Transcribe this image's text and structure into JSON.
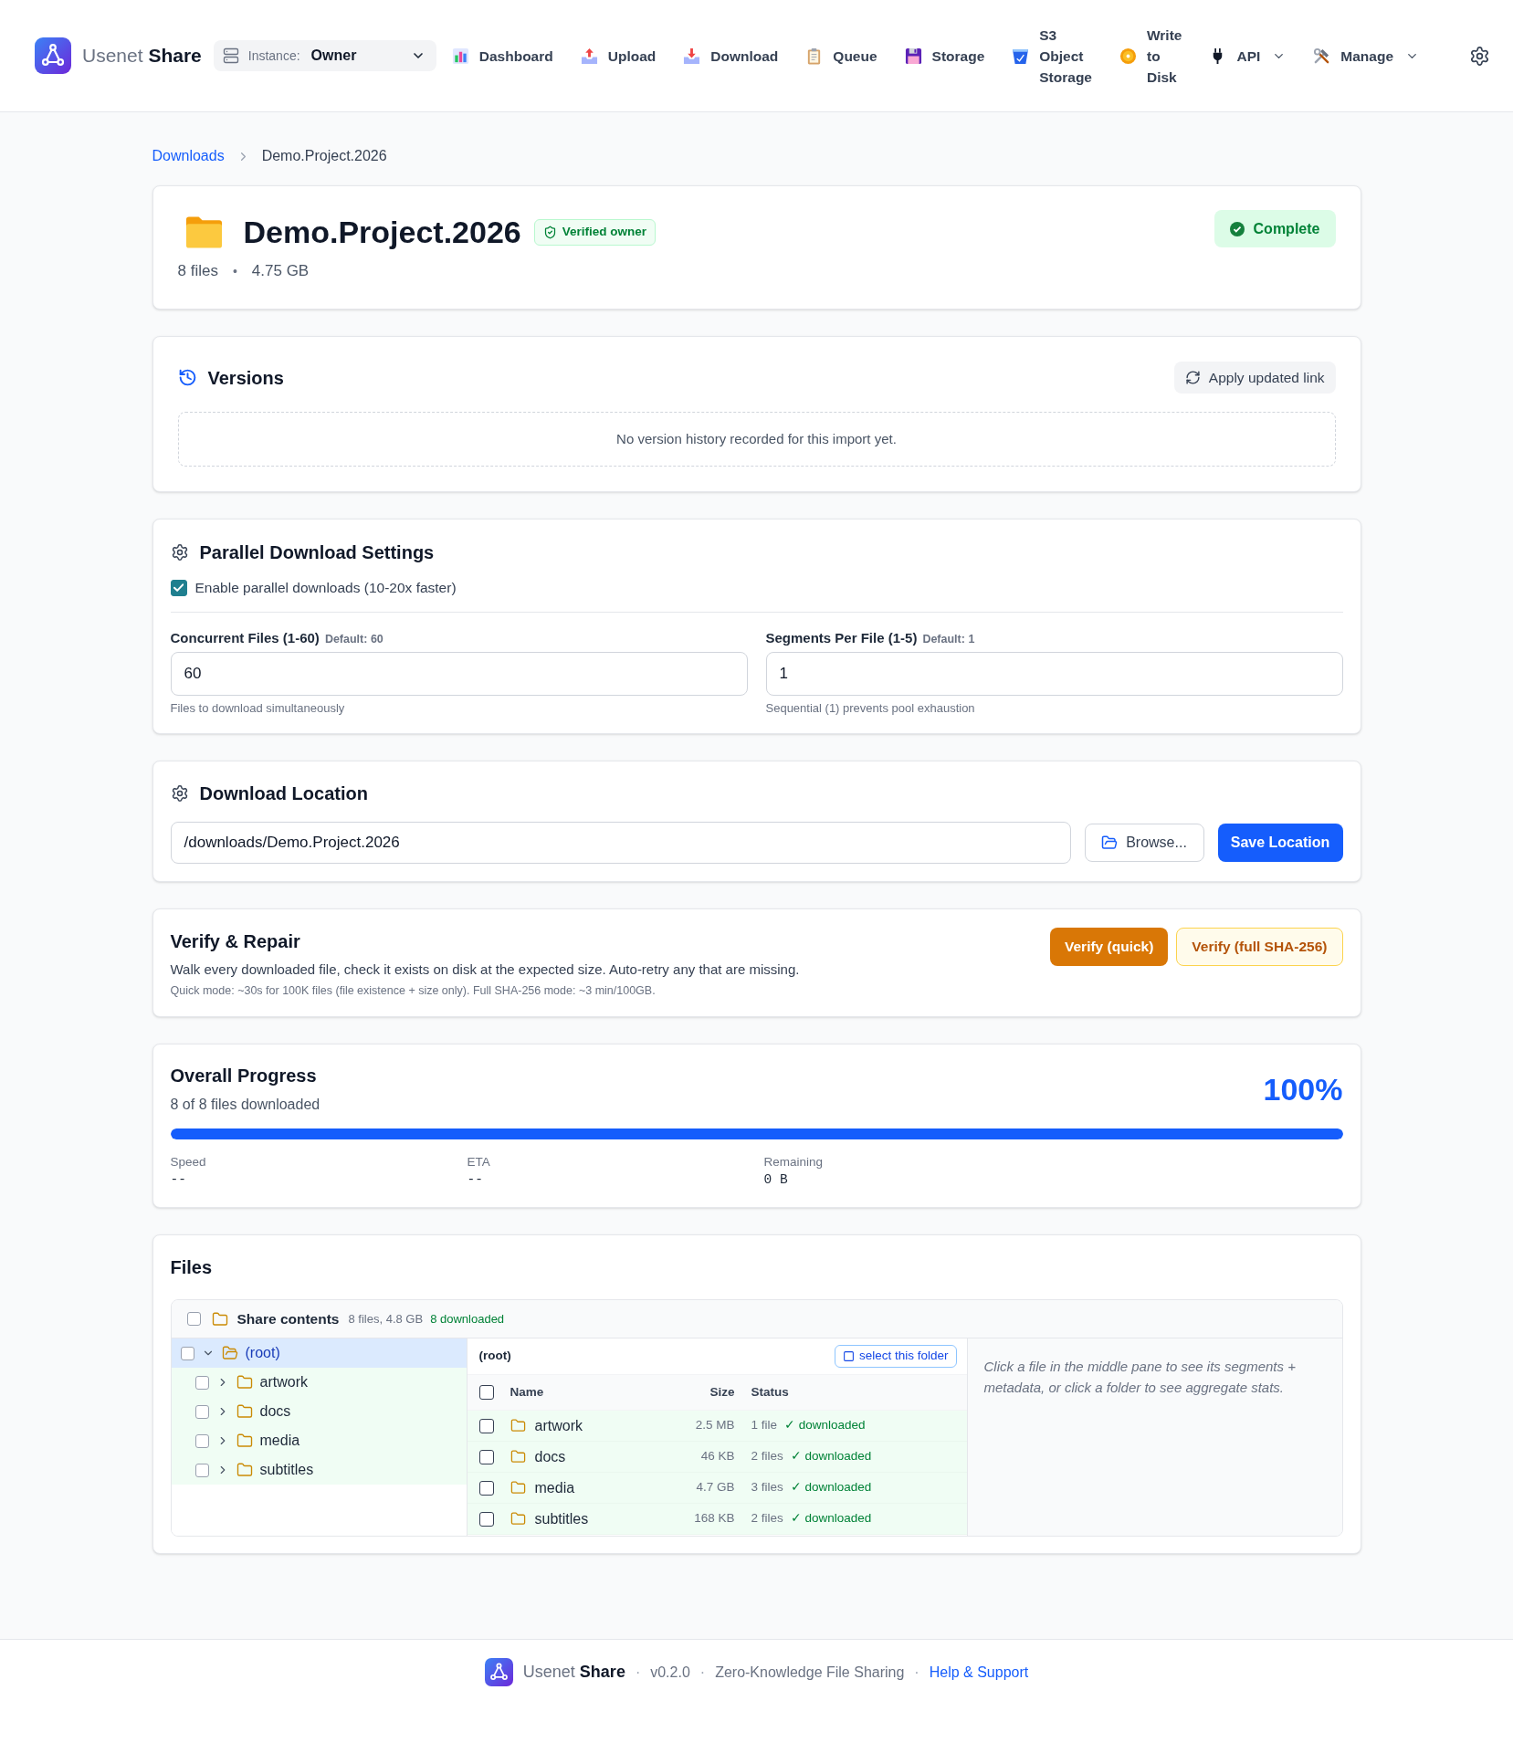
{
  "header": {
    "brand": {
      "light": "Usenet",
      "bold": "Share"
    },
    "instance": {
      "label": "Instance:",
      "value": "Owner"
    },
    "nav": [
      {
        "label": "Dashboard",
        "dropdown": false
      },
      {
        "label": "Upload",
        "dropdown": false
      },
      {
        "label": "Download",
        "dropdown": false
      },
      {
        "label": "Queue",
        "dropdown": false
      },
      {
        "label": "Storage",
        "dropdown": false
      },
      {
        "label": "S3 Object Storage",
        "dropdown": false
      },
      {
        "label": "Write to Disk",
        "dropdown": false
      },
      {
        "label": "API",
        "dropdown": true
      },
      {
        "label": "Manage",
        "dropdown": true
      }
    ]
  },
  "breadcrumb": [
    {
      "label": "Downloads",
      "kind": "link"
    },
    {
      "label": "Demo.Project.2026",
      "kind": "current"
    }
  ],
  "title_card": {
    "title": "Demo.Project.2026",
    "badge": "Verified owner",
    "file_count": "8 files",
    "separator": "•",
    "size": "4.75 GB",
    "status": "Complete"
  },
  "versions": {
    "title": "Versions",
    "button": "Apply updated link",
    "empty_text": "No version history recorded for this import yet."
  },
  "parallel_settings": {
    "title": "Parallel Download Settings",
    "enable": {
      "label": "Enable parallel downloads (10-20x faster)",
      "checked": true
    },
    "fields": [
      {
        "label": "Concurrent Files (1-60)",
        "default": "Default: 60",
        "value": "60",
        "hint": "Files to download simultaneously"
      },
      {
        "label": "Segments Per File (1-5)",
        "default": "Default: 1",
        "value": "1",
        "hint": "Sequential (1) prevents pool exhaustion"
      }
    ]
  },
  "download_location": {
    "title": "Download Location",
    "path": "/downloads/Demo.Project.2026",
    "buttons": [
      {
        "label": "Browse...",
        "kind": "secondary"
      },
      {
        "label": "Save Location",
        "kind": "primary"
      }
    ]
  },
  "verify_repair": {
    "title": "Verify & Repair",
    "description": "Walk every downloaded file, check it exists on disk at the expected size. Auto-retry any that are missing.",
    "note": "Quick mode: ~30s for 100K files (file existence + size only). Full SHA-256 mode: ~3 min/100GB.",
    "buttons": [
      {
        "label": "Verify (quick)",
        "kind": "primary"
      },
      {
        "label": "Verify (full SHA-256)",
        "kind": "secondary"
      }
    ]
  },
  "overall_progress": {
    "title": "Overall Progress",
    "subtitle": "8 of 8 files downloaded",
    "percent": "100%",
    "level": 1,
    "stats": [
      {
        "label": "Speed",
        "value": "--"
      },
      {
        "label": "ETA",
        "value": "--"
      },
      {
        "label": "Remaining",
        "value": "0 B"
      }
    ]
  },
  "files": {
    "title": "Files",
    "share": {
      "label": "Share contents",
      "summary": "8 files, 4.8 GB",
      "downloaded": "8 downloaded",
      "checked": false
    },
    "tree": [
      {
        "label": "(root)",
        "selected": true,
        "expanded": true,
        "checked": false,
        "children": [
          {
            "label": "artwork",
            "selected": false,
            "expanded": false,
            "checked": false,
            "downloaded": true
          },
          {
            "label": "docs",
            "selected": false,
            "expanded": false,
            "checked": false,
            "downloaded": true
          },
          {
            "label": "media",
            "selected": false,
            "expanded": false,
            "checked": false,
            "downloaded": true
          },
          {
            "label": "subtitles",
            "selected": false,
            "expanded": false,
            "checked": false,
            "downloaded": true
          }
        ]
      }
    ],
    "folder": {
      "path": "(root)",
      "select_button": "select this folder",
      "all_checked": false,
      "columns": [
        "Name",
        "Size",
        "Status"
      ],
      "rows": [
        {
          "name": "artwork",
          "size": "2.5 MB",
          "count": "1 file",
          "status": "✓ downloaded",
          "checked": false,
          "downloaded": true
        },
        {
          "name": "docs",
          "size": "46 KB",
          "count": "2 files",
          "status": "✓ downloaded",
          "checked": false,
          "downloaded": true
        },
        {
          "name": "media",
          "size": "4.7 GB",
          "count": "3 files",
          "status": "✓ downloaded",
          "checked": false,
          "downloaded": true
        },
        {
          "name": "subtitles",
          "size": "168 KB",
          "count": "2 files",
          "status": "✓ downloaded",
          "checked": false,
          "downloaded": true
        }
      ]
    },
    "detail_hint": "Click a file in the middle pane to see its segments + metadata, or click a folder to see aggregate stats."
  },
  "footer": {
    "brand": {
      "light": "Usenet",
      "bold": "Share"
    },
    "parts": [
      {
        "kind": "separator",
        "text": "·"
      },
      {
        "kind": "text",
        "text": "v0.2.0"
      },
      {
        "kind": "separator",
        "text": "·"
      },
      {
        "kind": "text",
        "text": "Zero-Knowledge File Sharing"
      },
      {
        "kind": "separator",
        "text": "·"
      },
      {
        "kind": "link",
        "text": "Help & Support"
      }
    ]
  }
}
